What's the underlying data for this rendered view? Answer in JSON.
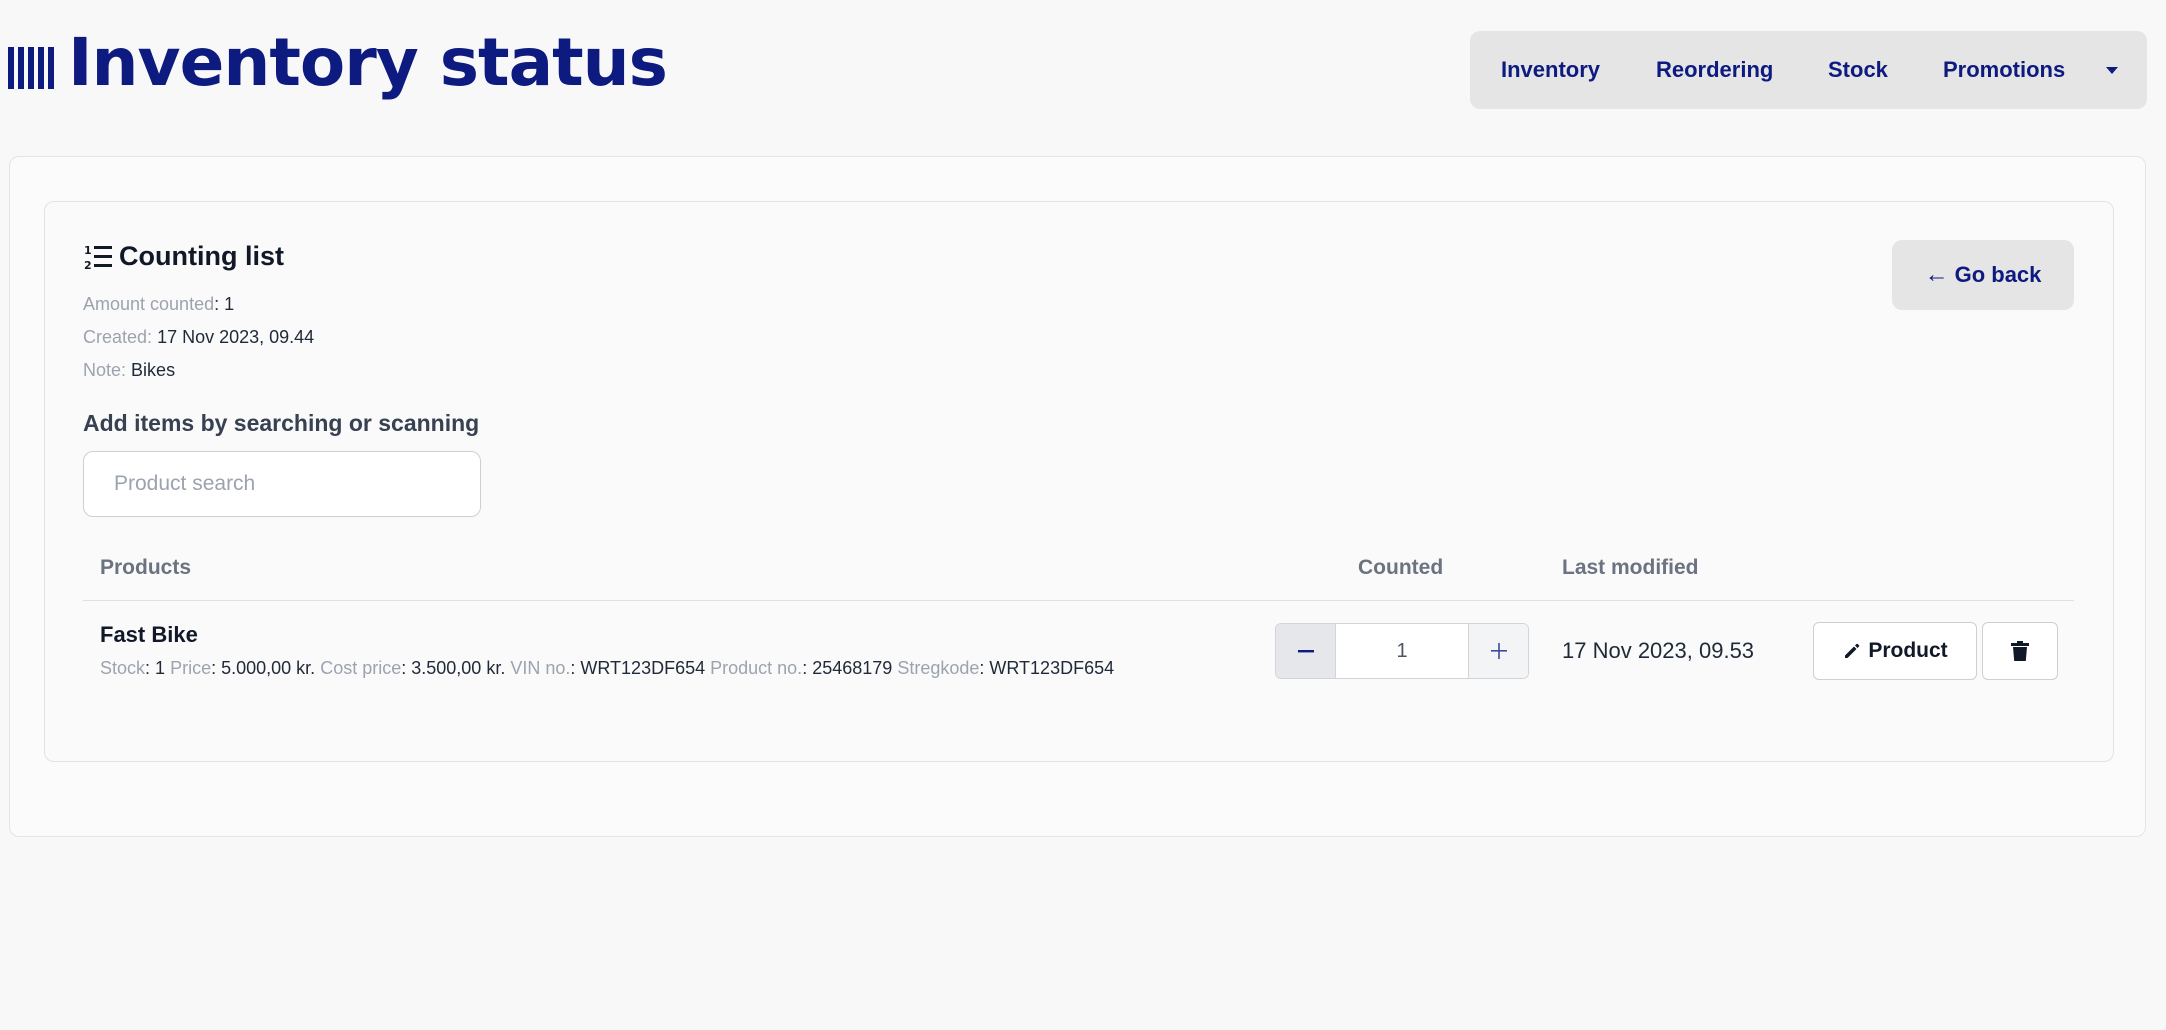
{
  "header": {
    "title": "Inventory status",
    "brand_icon": "barcode-icon",
    "nav": [
      {
        "label": "Inventory"
      },
      {
        "label": "Reordering"
      },
      {
        "label": "Stock"
      },
      {
        "label": "Promotions"
      }
    ],
    "nav_more_icon": "caret-down-icon"
  },
  "counting_list": {
    "icon": "numbered-list-icon",
    "title": "Counting list",
    "meta": {
      "amount_counted_label": "Amount counted",
      "amount_counted_value": "1",
      "created_label": "Created:",
      "created_value": "17 Nov 2023, 09.44",
      "note_label": "Note:",
      "note_value": "Bikes"
    },
    "go_back_label": "Go back",
    "go_back_icon": "arrow-left-icon"
  },
  "add_items": {
    "label": "Add items by searching or scanning",
    "search_placeholder": "Product search",
    "search_value": ""
  },
  "table": {
    "headers": {
      "products": "Products",
      "counted": "Counted",
      "last_modified": "Last modified"
    },
    "rows": [
      {
        "name": "Fast Bike",
        "stock_label": "Stock",
        "stock_value": "1",
        "price_label": "Price",
        "price_value": "5.000,00 kr.",
        "cost_price_label": "Cost price",
        "cost_price_value": "3.500,00 kr.",
        "vin_label": "VIN no.",
        "vin_value": "WRT123DF654",
        "product_no_label": "Product no.",
        "product_no_value": "25468179",
        "barcode_label": "Stregkode",
        "barcode_value": "WRT123DF654",
        "counted": "1",
        "last_modified": "17 Nov 2023, 09.53",
        "product_button_label": "Product",
        "product_button_icon": "pencil-icon",
        "delete_icon": "trash-icon",
        "decrement_icon": "minus-icon",
        "increment_icon": "plus-icon"
      }
    ]
  },
  "colors": {
    "brand": "#0d1a80",
    "background": "#f8f8f8",
    "muted_label": "#9ca3af",
    "nav_background": "#e5e5e5"
  }
}
